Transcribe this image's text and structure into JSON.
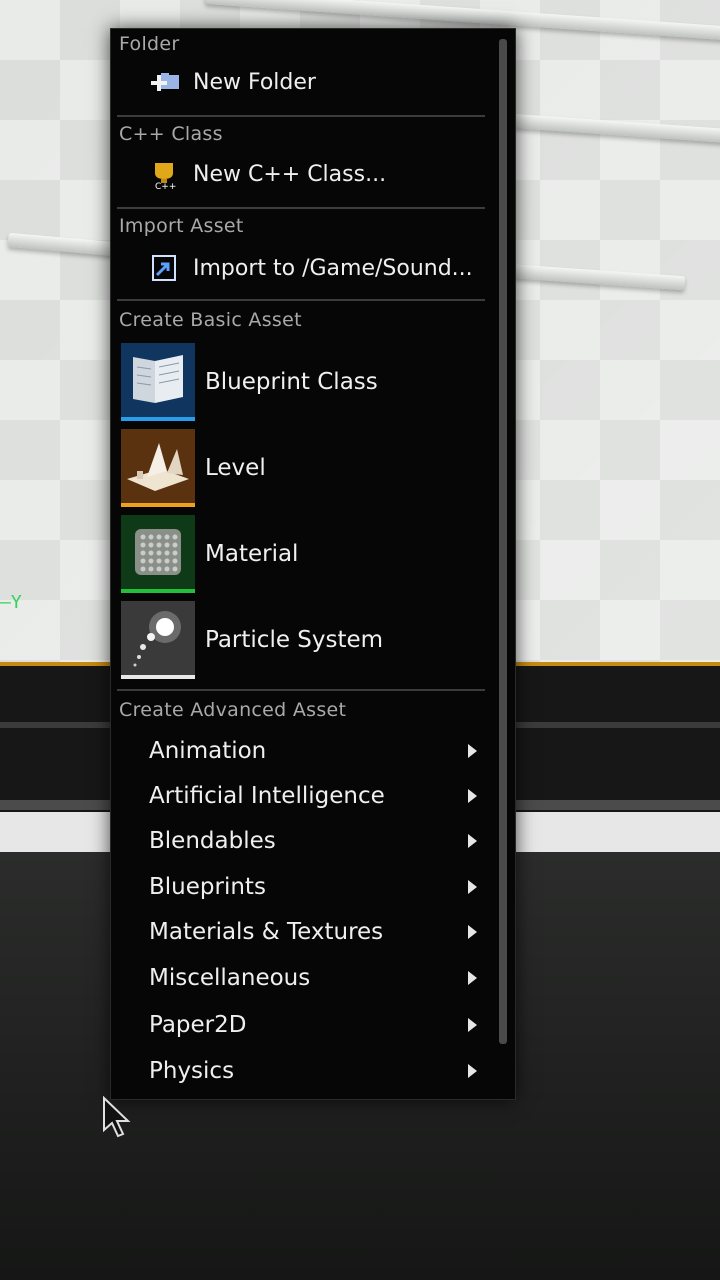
{
  "viewport": {
    "axis_label": "Y"
  },
  "menu": {
    "folder": {
      "header": "Folder",
      "new_folder": "New Folder",
      "icon": "folder-add-icon"
    },
    "cpp": {
      "header": "C++ Class",
      "new_class": "New C++ Class...",
      "icon": "cpp-class-icon"
    },
    "import": {
      "header": "Import Asset",
      "import_to": "Import to /Game/Sound...",
      "icon": "import-icon"
    },
    "basic": {
      "header": "Create Basic Asset",
      "items": [
        {
          "label": "Blueprint Class",
          "icon": "blueprint-class-icon",
          "accent": "#2a9de8"
        },
        {
          "label": "Level",
          "icon": "level-icon",
          "accent": "#f0a020"
        },
        {
          "label": "Material",
          "icon": "material-icon",
          "accent": "#22c03a"
        },
        {
          "label": "Particle System",
          "icon": "particle-system-icon",
          "accent": "#e8e8e8"
        }
      ]
    },
    "advanced": {
      "header": "Create Advanced Asset",
      "items": [
        {
          "label": "Animation"
        },
        {
          "label": "Artificial Intelligence"
        },
        {
          "label": "Blendables"
        },
        {
          "label": "Blueprints"
        },
        {
          "label": "Materials & Textures"
        },
        {
          "label": "Miscellaneous"
        },
        {
          "label": "Paper2D"
        },
        {
          "label": "Physics"
        }
      ]
    }
  }
}
